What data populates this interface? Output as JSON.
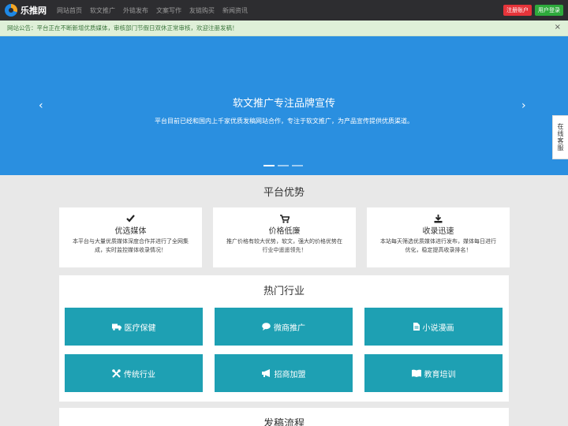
{
  "nav": {
    "logo_text": "乐推网",
    "links": [
      "网站首页",
      "软文推广",
      "外链发布",
      "文案写作",
      "友链购买",
      "新闻资讯"
    ],
    "register": "注册账户",
    "login": "用户登录"
  },
  "notice": {
    "text": "网站公告：平台正在不断新增优质媒体，审核部门节假日双休正常审核，欢迎注册发稿！",
    "close": "×"
  },
  "banner": {
    "title": "软文推广专注品牌宣传",
    "subtitle": "平台目前已经和国内上千家优质发稿网站合作，专注于软文推广，为产品宣传提供优质渠道。",
    "prev": "‹",
    "next": "›",
    "slide_count": 3,
    "active_slide": 0
  },
  "side_service": "在线客服",
  "advantages": {
    "title": "平台优势",
    "cards": [
      {
        "icon": "check-icon",
        "title": "优选媒体",
        "desc": "本平台与大量优质媒体深度合作并进行了全网集成，实时监控媒体收录情况！"
      },
      {
        "icon": "cart-icon",
        "title": "价格低廉",
        "desc": "推广价格有较大优势，软文，强大的价格优势在行业中遥遥领先！"
      },
      {
        "icon": "download-icon",
        "title": "收录迅速",
        "desc": "本站每天筛选优质媒体进行发布，媒体每日进行优化，稳定提高收录排名！"
      }
    ]
  },
  "industries": {
    "title": "热门行业",
    "tiles": [
      {
        "icon": "truck-icon",
        "label": "医疗保健"
      },
      {
        "icon": "chat-icon",
        "label": "微商推广"
      },
      {
        "icon": "file-icon",
        "label": "小说漫画"
      },
      {
        "icon": "tools-icon",
        "label": "传统行业"
      },
      {
        "icon": "bullhorn-icon",
        "label": "招商加盟"
      },
      {
        "icon": "book-icon",
        "label": "教育培训"
      }
    ]
  },
  "process": {
    "title": "发稿流程"
  },
  "colors": {
    "nav_bg": "#2d2d30",
    "banner_bg": "#2a8fe0",
    "tile_bg": "#1ea0b3",
    "register_btn": "#e5343a",
    "login_btn": "#2eaa3c"
  }
}
